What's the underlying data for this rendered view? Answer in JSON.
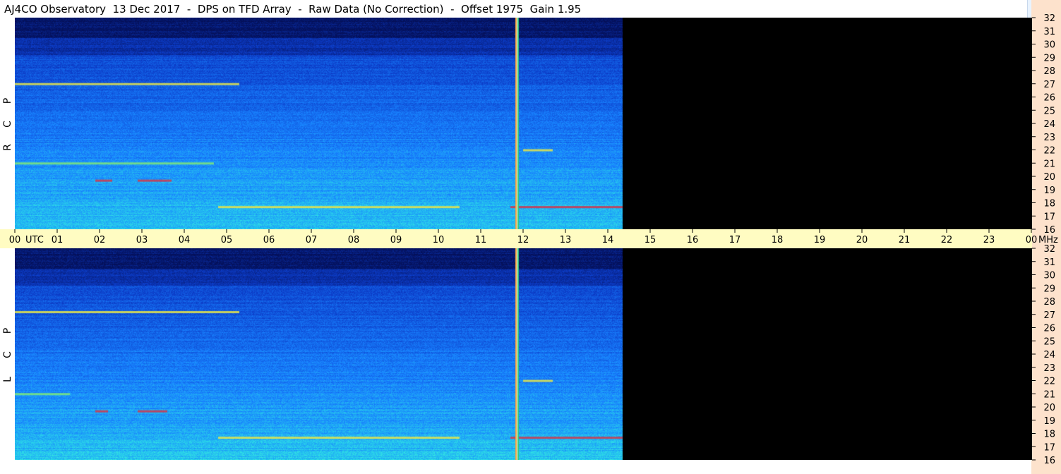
{
  "title": "AJ4CO Observatory  13 Dec 2017  -  DPS on TFD Array  -  Raw Data (No Correction)  -  Offset 1975  Gain 1.95",
  "chart_data": [
    {
      "type": "heatmap",
      "panel": "RCP",
      "side_label": [
        "R",
        "C",
        "P"
      ],
      "x_axis": {
        "unit_label": "UTC",
        "range_hours": [
          0,
          24
        ],
        "tick_labels": [
          "00",
          "01",
          "02",
          "03",
          "04",
          "05",
          "06",
          "07",
          "08",
          "09",
          "10",
          "11",
          "12",
          "13",
          "14",
          "15",
          "16",
          "17",
          "18",
          "19",
          "20",
          "21",
          "22",
          "23",
          "00"
        ]
      },
      "y_axis": {
        "unit_label": "MHz",
        "range_mhz": [
          16,
          32
        ],
        "tick_labels": [
          "32",
          "31",
          "30",
          "29",
          "28",
          "27",
          "26",
          "25",
          "24",
          "23",
          "22",
          "21",
          "20",
          "19",
          "18",
          "17",
          "16"
        ]
      },
      "data_end_hour": 14.35,
      "gap_hour": 11.85,
      "features": [
        {
          "kind": "band",
          "freq_mhz": 27.0,
          "start_hour": 0.0,
          "end_hour": 5.3,
          "intensity": "yellow"
        },
        {
          "kind": "band",
          "freq_mhz": 21.0,
          "start_hour": 0.0,
          "end_hour": 4.7,
          "intensity": "green"
        },
        {
          "kind": "band",
          "freq_mhz": 19.7,
          "start_hour": 1.9,
          "end_hour": 2.3,
          "intensity": "red"
        },
        {
          "kind": "band",
          "freq_mhz": 19.7,
          "start_hour": 2.9,
          "end_hour": 3.7,
          "intensity": "red"
        },
        {
          "kind": "band",
          "freq_mhz": 17.7,
          "start_hour": 4.8,
          "end_hour": 10.5,
          "intensity": "yellow"
        },
        {
          "kind": "band",
          "freq_mhz": 17.7,
          "start_hour": 11.7,
          "end_hour": 14.35,
          "intensity": "red"
        },
        {
          "kind": "band",
          "freq_mhz": 22.0,
          "start_hour": 12.0,
          "end_hour": 12.7,
          "intensity": "yellow"
        }
      ]
    },
    {
      "type": "heatmap",
      "panel": "LCP",
      "side_label": [
        "L",
        "C",
        "P"
      ],
      "x_axis": {
        "unit_label": "UTC",
        "range_hours": [
          0,
          24
        ]
      },
      "y_axis": {
        "unit_label": "MHz",
        "range_mhz": [
          16,
          32
        ],
        "tick_labels": [
          "32",
          "31",
          "30",
          "29",
          "28",
          "27",
          "26",
          "25",
          "24",
          "23",
          "22",
          "21",
          "20",
          "19",
          "18",
          "17",
          "16"
        ]
      },
      "data_end_hour": 14.35,
      "gap_hour": 11.85,
      "features": [
        {
          "kind": "band",
          "freq_mhz": 27.2,
          "start_hour": 0.0,
          "end_hour": 5.3,
          "intensity": "yellow"
        },
        {
          "kind": "band",
          "freq_mhz": 21.0,
          "start_hour": 0.0,
          "end_hour": 1.3,
          "intensity": "green"
        },
        {
          "kind": "band",
          "freq_mhz": 19.7,
          "start_hour": 1.9,
          "end_hour": 2.2,
          "intensity": "red"
        },
        {
          "kind": "band",
          "freq_mhz": 19.7,
          "start_hour": 2.9,
          "end_hour": 3.6,
          "intensity": "red"
        },
        {
          "kind": "band",
          "freq_mhz": 17.7,
          "start_hour": 4.8,
          "end_hour": 10.5,
          "intensity": "yellow"
        },
        {
          "kind": "band",
          "freq_mhz": 17.7,
          "start_hour": 11.7,
          "end_hour": 14.35,
          "intensity": "red"
        },
        {
          "kind": "band",
          "freq_mhz": 22.0,
          "start_hour": 12.0,
          "end_hour": 12.7,
          "intensity": "yellow"
        }
      ]
    }
  ],
  "colors": {
    "background": "#000000",
    "noise_low": "#0b2a9a",
    "noise_mid": "#1a7aff",
    "noise_high": "#27d0ef",
    "time_axis_bg": "#fffcc2",
    "freq_axis_bg": "#fde2cc"
  }
}
